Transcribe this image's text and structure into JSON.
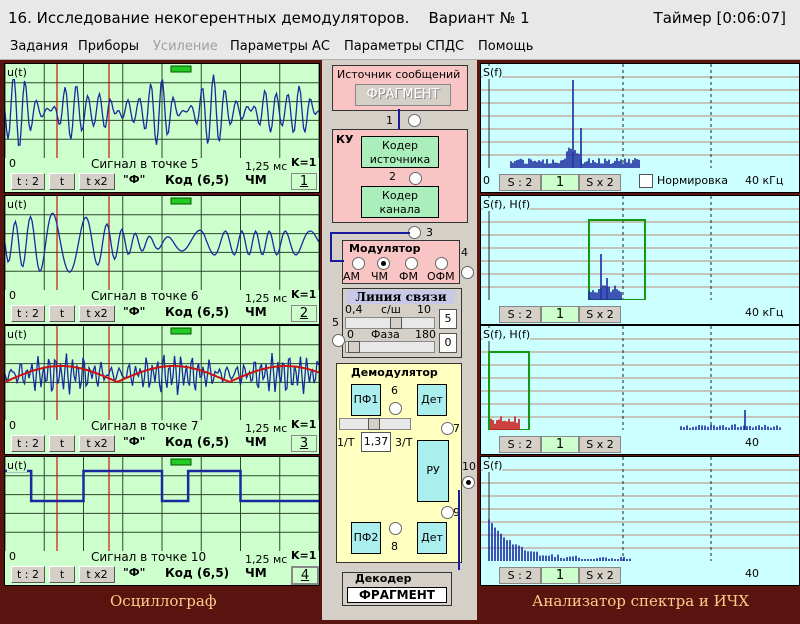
{
  "window": {
    "title": "16. Исследование некогерентных демодуляторов.    Вариант № 1",
    "timer": "Таймер [0:06:07]"
  },
  "menu": [
    "Задания",
    "Приборы",
    "Усиление",
    "Параметры АС",
    "Параметры СПДС",
    "Помощь"
  ],
  "scope": {
    "channels": [
      {
        "ylabel": "u(t)",
        "zero": "0",
        "caption": "Сигнал в точке 5",
        "time": "1,25 мс",
        "k": "K=1",
        "btn1": "t : 2",
        "btn2": "t",
        "btn3": "t x2",
        "quote": "\"Ф\"",
        "code": "Код (6,5)",
        "mod": "ЧМ",
        "num": "1"
      },
      {
        "ylabel": "u(t)",
        "zero": "0",
        "caption": "Сигнал в точке 6",
        "time": "1,25 мс",
        "k": "K=1",
        "btn1": "t : 2",
        "btn2": "t",
        "btn3": "t x2",
        "quote": "\"Ф\"",
        "code": "Код (6,5)",
        "mod": "ЧМ",
        "num": "2"
      },
      {
        "ylabel": "u(t)",
        "zero": "0",
        "caption": "Сигнал в точке 7",
        "time": "1,25 мс",
        "k": "K=1",
        "btn1": "t : 2",
        "btn2": "t",
        "btn3": "t x2",
        "quote": "\"Ф\"",
        "code": "Код (6,5)",
        "mod": "ЧМ",
        "num": "3"
      },
      {
        "ylabel": "u(t)",
        "zero": "0",
        "caption": "Сигнал в точке 10",
        "time": "1,25 мс",
        "k": "K=1",
        "btn1": "t : 2",
        "btn2": "t",
        "btn3": "t x2",
        "quote": "\"Ф\"",
        "code": "Код (6,5)",
        "mod": "ЧМ",
        "num": "4"
      }
    ],
    "footer": "Осциллограф"
  },
  "center": {
    "source_title": "Источник сообщений",
    "source_value": "ФРАГМЕНТ",
    "ku": "КУ",
    "coder_source": "Кодер источника",
    "coder_channel": "Кодер канала",
    "p1": "1",
    "p2": "2",
    "p3": "3",
    "p4": "4",
    "p5": "5",
    "p6": "6",
    "p7": "7",
    "p8": "8",
    "p9": "9",
    "p10": "10",
    "modulator": "Модулятор",
    "mod_opts": [
      "АМ",
      "ЧМ",
      "ФМ",
      "ОФМ"
    ],
    "channel_title": "Линия связи",
    "sn_min": "0,4",
    "sn_label": "с/ш",
    "sn_max": "10",
    "sn_value": "5",
    "phase_min": "0",
    "phase_label": "Фаза",
    "phase_max": "180",
    "phase_value": "0",
    "demod": "Демодулятор",
    "pf1": "ПФ1",
    "pf2": "ПФ2",
    "det": "Дет",
    "ru": "РУ",
    "t_min": "1/T",
    "t_value": "1,37",
    "t_max": "3/T",
    "decoder": "Декодер",
    "decoder_value": "ФРАГМЕНТ"
  },
  "spectrum": {
    "panels": [
      {
        "ylabel": "S(f)",
        "zero": "0",
        "btn1": "S : 2",
        "val": "1",
        "btn2": "S x 2",
        "norm": "Нормировка",
        "unit": "40 кГц"
      },
      {
        "ylabel": "S(f), H(f)",
        "btn1": "S : 2",
        "val": "1",
        "btn2": "S x 2",
        "unit": "40 кГц"
      },
      {
        "ylabel": "S(f), H(f)",
        "btn1": "S : 2",
        "val": "1",
        "btn2": "S x 2",
        "unit": "40"
      },
      {
        "ylabel": "S(f)",
        "btn1": "S : 2",
        "val": "1",
        "btn2": "S x 2",
        "unit": "40"
      }
    ],
    "footer": "Анализатор спектра и ИЧХ"
  },
  "colors": {
    "scope_bg": "#ccffcc",
    "spec_bg": "#ccffff",
    "frame": "#5a1410",
    "trace": "#1a2a9e",
    "envelope": "#cc1111",
    "filter": "#119911"
  }
}
